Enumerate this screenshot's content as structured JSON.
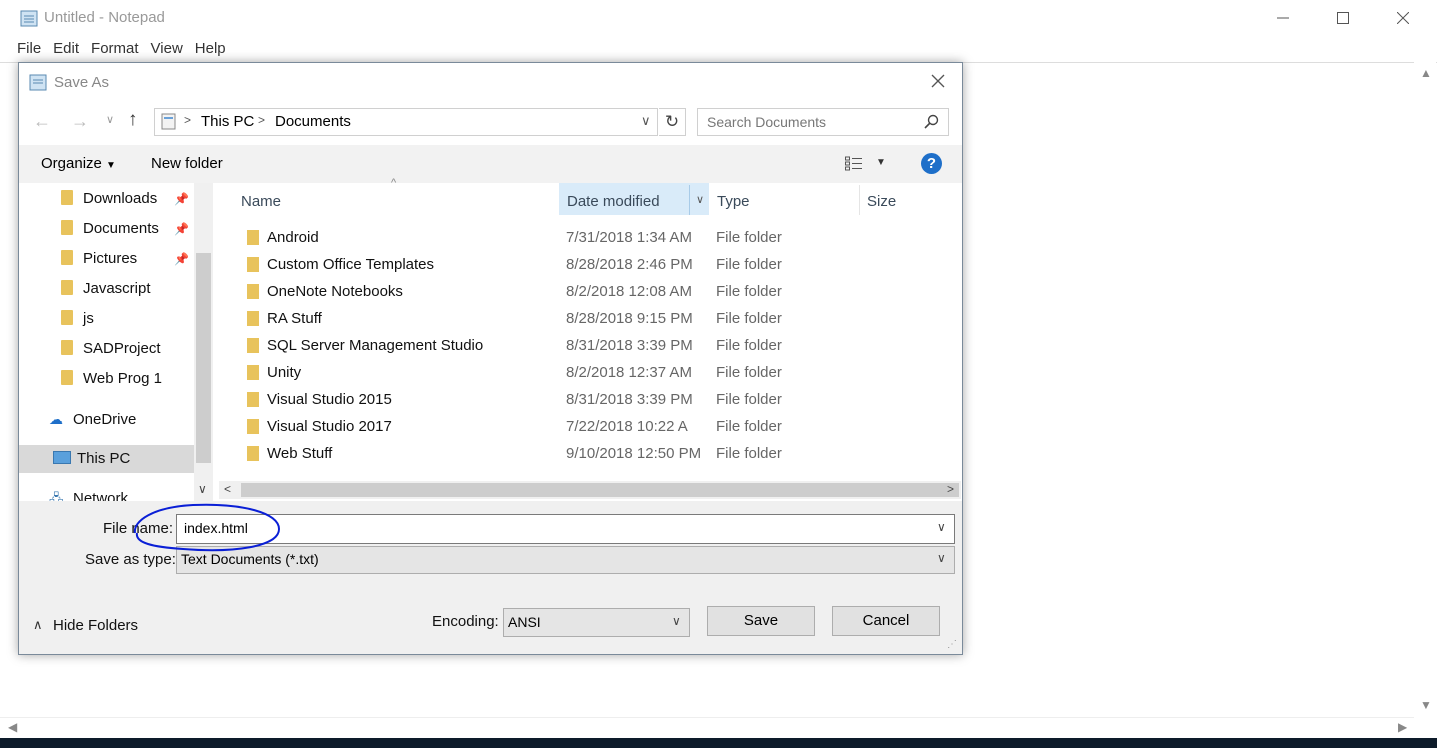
{
  "notepad": {
    "title": "Untitled - Notepad",
    "menu": [
      "File",
      "Edit",
      "Format",
      "View",
      "Help"
    ]
  },
  "dialog": {
    "title": "Save As",
    "address": {
      "crumbs": [
        "This PC",
        "Documents"
      ]
    },
    "search": {
      "placeholder": "Search Documents"
    },
    "toolbar": {
      "organize": "Organize",
      "new_folder": "New folder"
    },
    "nav_items": [
      {
        "label": "Downloads",
        "pinned": true
      },
      {
        "label": "Documents",
        "pinned": true
      },
      {
        "label": "Pictures",
        "pinned": true
      },
      {
        "label": "Javascript",
        "pinned": false
      },
      {
        "label": "js",
        "pinned": false
      },
      {
        "label": "SADProject",
        "pinned": false
      },
      {
        "label": "Web Prog 1",
        "pinned": false
      },
      {
        "label": "OneDrive",
        "pinned": false
      },
      {
        "label": "This PC",
        "pinned": false,
        "selected": true
      },
      {
        "label": "Network",
        "pinned": false
      }
    ],
    "columns": [
      "Name",
      "Date modified",
      "Type",
      "Size"
    ],
    "files": [
      {
        "name": "Android",
        "date": "7/31/2018 1:34 AM",
        "type": "File folder"
      },
      {
        "name": "Custom Office Templates",
        "date": "8/28/2018 2:46 PM",
        "type": "File folder"
      },
      {
        "name": "OneNote Notebooks",
        "date": "8/2/2018 12:08 AM",
        "type": "File folder"
      },
      {
        "name": "RA Stuff",
        "date": "8/28/2018 9:15 PM",
        "type": "File folder"
      },
      {
        "name": "SQL Server Management Studio",
        "date": "8/31/2018 3:39 PM",
        "type": "File folder"
      },
      {
        "name": "Unity",
        "date": "8/2/2018 12:37 AM",
        "type": "File folder"
      },
      {
        "name": "Visual Studio 2015",
        "date": "8/31/2018 3:39 PM",
        "type": "File folder"
      },
      {
        "name": "Visual Studio 2017",
        "date": "7/22/2018 10:22 A",
        "type": "File folder"
      },
      {
        "name": "Web Stuff",
        "date": "9/10/2018 12:50 PM",
        "type": "File folder"
      }
    ],
    "file_name_label": "File name:",
    "file_name_value": "index.html",
    "save_type_label": "Save as type:",
    "save_type_value": "Text Documents (*.txt)",
    "hide_folders": "Hide Folders",
    "encoding_label": "Encoding:",
    "encoding_value": "ANSI",
    "save_label": "Save",
    "cancel_label": "Cancel"
  },
  "colors": {
    "selection": "#cce8ff",
    "annotation": "#0a1fd6",
    "help": "#1e6fc9"
  }
}
